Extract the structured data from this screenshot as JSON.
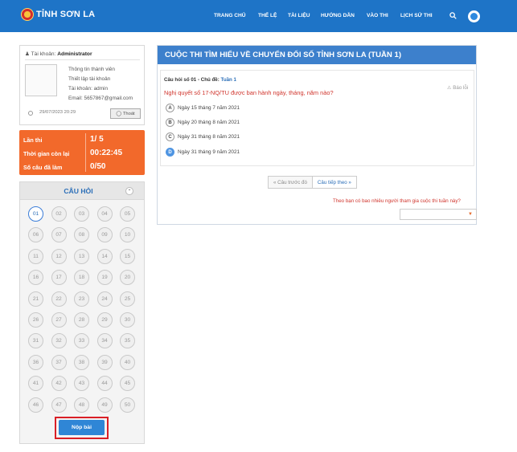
{
  "header": {
    "brand": "TỈNH SƠN LA",
    "nav": [
      "TRANG CHỦ",
      "THỂ LỆ",
      "TÀI LIỆU",
      "HƯỚNG DẪN",
      "VÀO THI",
      "LỊCH SỬ THI"
    ],
    "icons": [
      "search-icon",
      "user-avatar-icon"
    ],
    "accent_color": "#1e74c7"
  },
  "user": {
    "account_label": "Tài khoản:",
    "account_name": "Administrator",
    "links": [
      "Thông tin thành viên",
      "Thiết lập tài khoản"
    ],
    "username_line": "Tài khoản: admin",
    "email_line": "Email: 5657867@gmail.com",
    "datetime": "29/07/2023 20:29",
    "exit_label": "Thoát"
  },
  "stats": [
    {
      "label": "Lần thi",
      "value": "1/ 5"
    },
    {
      "label": "Thời gian còn lại",
      "value": "00:22:45"
    },
    {
      "label": "Số câu đã làm",
      "value": "0/50"
    }
  ],
  "question_panel": {
    "title": "CÂU HỎI",
    "numbers": [
      "01",
      "02",
      "03",
      "04",
      "05",
      "06",
      "07",
      "08",
      "09",
      "10",
      "11",
      "12",
      "13",
      "14",
      "15",
      "16",
      "17",
      "18",
      "19",
      "20",
      "21",
      "22",
      "23",
      "24",
      "25",
      "26",
      "27",
      "28",
      "29",
      "30",
      "31",
      "32",
      "33",
      "34",
      "35",
      "36",
      "37",
      "38",
      "39",
      "40",
      "41",
      "42",
      "43",
      "44",
      "45",
      "46",
      "47",
      "48",
      "49",
      "50"
    ],
    "active": "01",
    "submit_label": "Nộp bài"
  },
  "contest": {
    "title": "CUỘC THI TÌM HIỂU VỀ CHUYỂN ĐỔI SỐ TỈNH SƠN LA (TUẦN 1)",
    "meta_prefix": "Câu hỏi số 01 - Chủ đề:",
    "topic": "Tuần 1",
    "report_label": "Báo lỗi",
    "question": "Nghị quyết số 17-NQ/TU được ban hành ngày, tháng, năm nào?",
    "options": [
      {
        "letter": "A",
        "text": "Ngày 15 tháng 7 năm 2021"
      },
      {
        "letter": "B",
        "text": "Ngày 20 tháng 8 năm 2021"
      },
      {
        "letter": "C",
        "text": "Ngày 31 tháng 8 năm 2021"
      },
      {
        "letter": "D",
        "text": "Ngày 31 tháng 9 năm 2021"
      }
    ],
    "selected_option": "D",
    "prev_label": "« Câu trước đó",
    "next_label": "Câu tiếp theo »",
    "survey_question": "Theo bạn có bao nhiêu người tham gia cuộc thi tuần này?",
    "survey_value": ""
  }
}
